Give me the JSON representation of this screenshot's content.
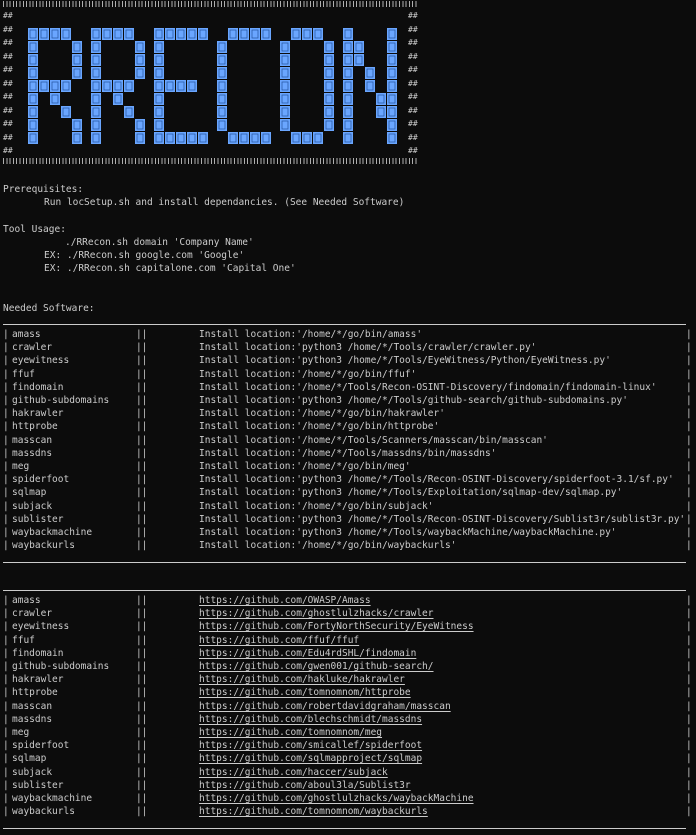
{
  "banner": {
    "hash_char": "#",
    "side_marker": "##",
    "logo_text": "RRECON",
    "logo_color": "#6aa6ff"
  },
  "prereq": {
    "title": "Prerequisites:",
    "line": "Run locSetup.sh and install dependancies. (See Needed Software)"
  },
  "usage": {
    "title": "Tool Usage:",
    "syntax": "./RRecon.sh domain 'Company Name'",
    "ex1": "EX: ./RRecon.sh google.com 'Google'",
    "ex2": "EX: ./RRecon.sh capitalone.com 'Capital One'"
  },
  "software": {
    "title": "Needed Software:",
    "separator": "||",
    "locations": [
      {
        "name": "amass",
        "loc": "Install location:'/home/*/go/bin/amass'"
      },
      {
        "name": "crawler",
        "loc": "Install location:'python3 /home/*/Tools/crawler/crawler.py'"
      },
      {
        "name": "eyewitness",
        "loc": "Install location:'python3 /home/*/Tools/EyeWitness/Python/EyeWitness.py'"
      },
      {
        "name": "ffuf",
        "loc": "Install location:'/home/*/go/bin/ffuf'"
      },
      {
        "name": "findomain",
        "loc": "Install location:'/home/*/Tools/Recon-OSINT-Discovery/findomain/findomain-linux'"
      },
      {
        "name": "github-subdomains",
        "loc": "Install location:'python3 /home/*/Tools/github-search/github-subdomains.py'"
      },
      {
        "name": "hakrawler",
        "loc": "Install location:'/home/*/go/bin/hakrawler'"
      },
      {
        "name": "httprobe",
        "loc": "Install location:'/home/*/go/bin/httprobe'"
      },
      {
        "name": "masscan",
        "loc": "Install location:'/home/*/Tools/Scanners/masscan/bin/masscan'"
      },
      {
        "name": "massdns",
        "loc": "Install location:'/home/*/Tools/massdns/bin/massdns'"
      },
      {
        "name": "meg",
        "loc": "Install location:'/home/*/go/bin/meg'"
      },
      {
        "name": "spiderfoot",
        "loc": "Install location:'python3 /home/*/Tools/Recon-OSINT-Discovery/spiderfoot-3.1/sf.py'"
      },
      {
        "name": "sqlmap",
        "loc": "Install location:'python3 /home/*/Tools/Exploitation/sqlmap-dev/sqlmap.py'"
      },
      {
        "name": "subjack",
        "loc": "Install location:'/home/*/go/bin/subjack'"
      },
      {
        "name": "sublister",
        "loc": "Install location:'python3 /home/*/Tools/Recon-OSINT-Discovery/Sublist3r/sublist3r.py'"
      },
      {
        "name": "waybackmachine",
        "loc": "Install location:'python3 /home/*/Tools/waybackMachine/waybackMachine.py'"
      },
      {
        "name": "waybackurls",
        "loc": "Install location:'/home/*/go/bin/waybackurls'"
      }
    ],
    "links": [
      {
        "name": "amass",
        "url": "https://github.com/OWASP/Amass"
      },
      {
        "name": "crawler",
        "url": "https://github.com/ghostlulzhacks/crawler"
      },
      {
        "name": "eyewitness",
        "url": "https://github.com/FortyNorthSecurity/EyeWitness"
      },
      {
        "name": "ffuf",
        "url": "https://github.com/ffuf/ffuf"
      },
      {
        "name": "findomain",
        "url": "https://github.com/Edu4rdSHL/findomain"
      },
      {
        "name": "github-subdomains",
        "url": "https://github.com/gwen001/github-search/"
      },
      {
        "name": "hakrawler",
        "url": "https://github.com/hakluke/hakrawler"
      },
      {
        "name": "httprobe",
        "url": "https://github.com/tomnomnom/httprobe"
      },
      {
        "name": "masscan",
        "url": "https://github.com/robertdavidgraham/masscan"
      },
      {
        "name": "massdns",
        "url": "https://github.com/blechschmidt/massdns"
      },
      {
        "name": "meg",
        "url": "https://github.com/tomnomnom/meg"
      },
      {
        "name": "spiderfoot",
        "url": "https://github.com/smicallef/spiderfoot"
      },
      {
        "name": "sqlmap",
        "url": "https://github.com/sqlmapproject/sqlmap"
      },
      {
        "name": "subjack",
        "url": "https://github.com/haccer/subjack"
      },
      {
        "name": "sublister",
        "url": "https://github.com/aboul3la/Sublist3r"
      },
      {
        "name": "waybackmachine",
        "url": "https://github.com/ghostlulzhacks/waybackMachine"
      },
      {
        "name": "waybackurls",
        "url": "https://github.com/tomnomnom/waybackurls"
      }
    ]
  }
}
